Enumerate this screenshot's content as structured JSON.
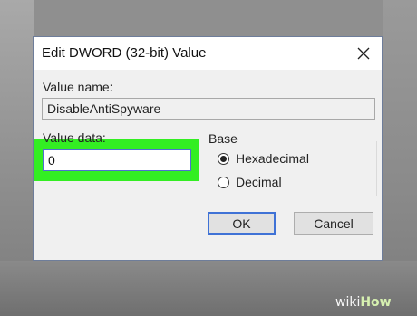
{
  "dialog": {
    "title": "Edit DWORD (32-bit) Value",
    "value_name_label": "Value name:",
    "value_name": "DisableAntiSpyware",
    "value_data_label": "Value data:",
    "value_data": "0",
    "base_label": "Base",
    "base_options": [
      {
        "label": "Hexadecimal",
        "selected": true
      },
      {
        "label": "Decimal",
        "selected": false
      }
    ],
    "ok_label": "OK",
    "cancel_label": "Cancel"
  },
  "watermark": {
    "part1": "wiki",
    "part2": "How"
  },
  "colors": {
    "highlight": "#33ee22",
    "focus_border": "#3f72d6",
    "dialog_bg": "#f0f0f0"
  }
}
